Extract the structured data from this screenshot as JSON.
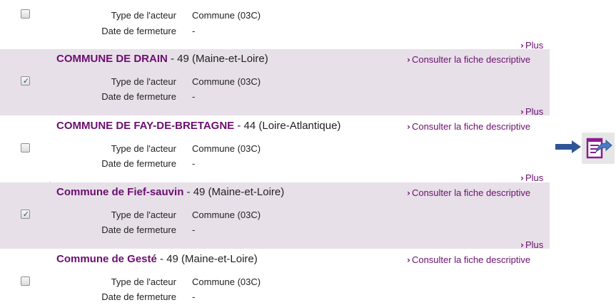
{
  "common": {
    "type_label": "Type de l'acteur",
    "type_value": "Commune (03C)",
    "closing_label": "Date de fermeture",
    "closing_value": "-",
    "consult_label": "Consulter la fiche descriptive",
    "plus_label": "Plus"
  },
  "entries": [
    {
      "name": "",
      "region": "",
      "checked": false
    },
    {
      "name": "COMMUNE DE DRAIN",
      "region": " - 49 (Maine-et-Loire)",
      "checked": true
    },
    {
      "name": "COMMUNE DE FAY-DE-BRETAGNE",
      "region": " - 44 (Loire-Atlantique)",
      "checked": false
    },
    {
      "name": "Commune de Fief-sauvin",
      "region": " - 49 (Maine-et-Loire)",
      "checked": true
    },
    {
      "name": "Commune de Gesté",
      "region": " - 49 (Maine-et-Loire)",
      "checked": false
    }
  ],
  "colors": {
    "accent": "#6b0f6f",
    "row_shade": "#e8e0e9",
    "arrow": "#2f5597"
  },
  "icons": {
    "arrow": "arrow-right-icon",
    "export": "export-document-icon"
  }
}
